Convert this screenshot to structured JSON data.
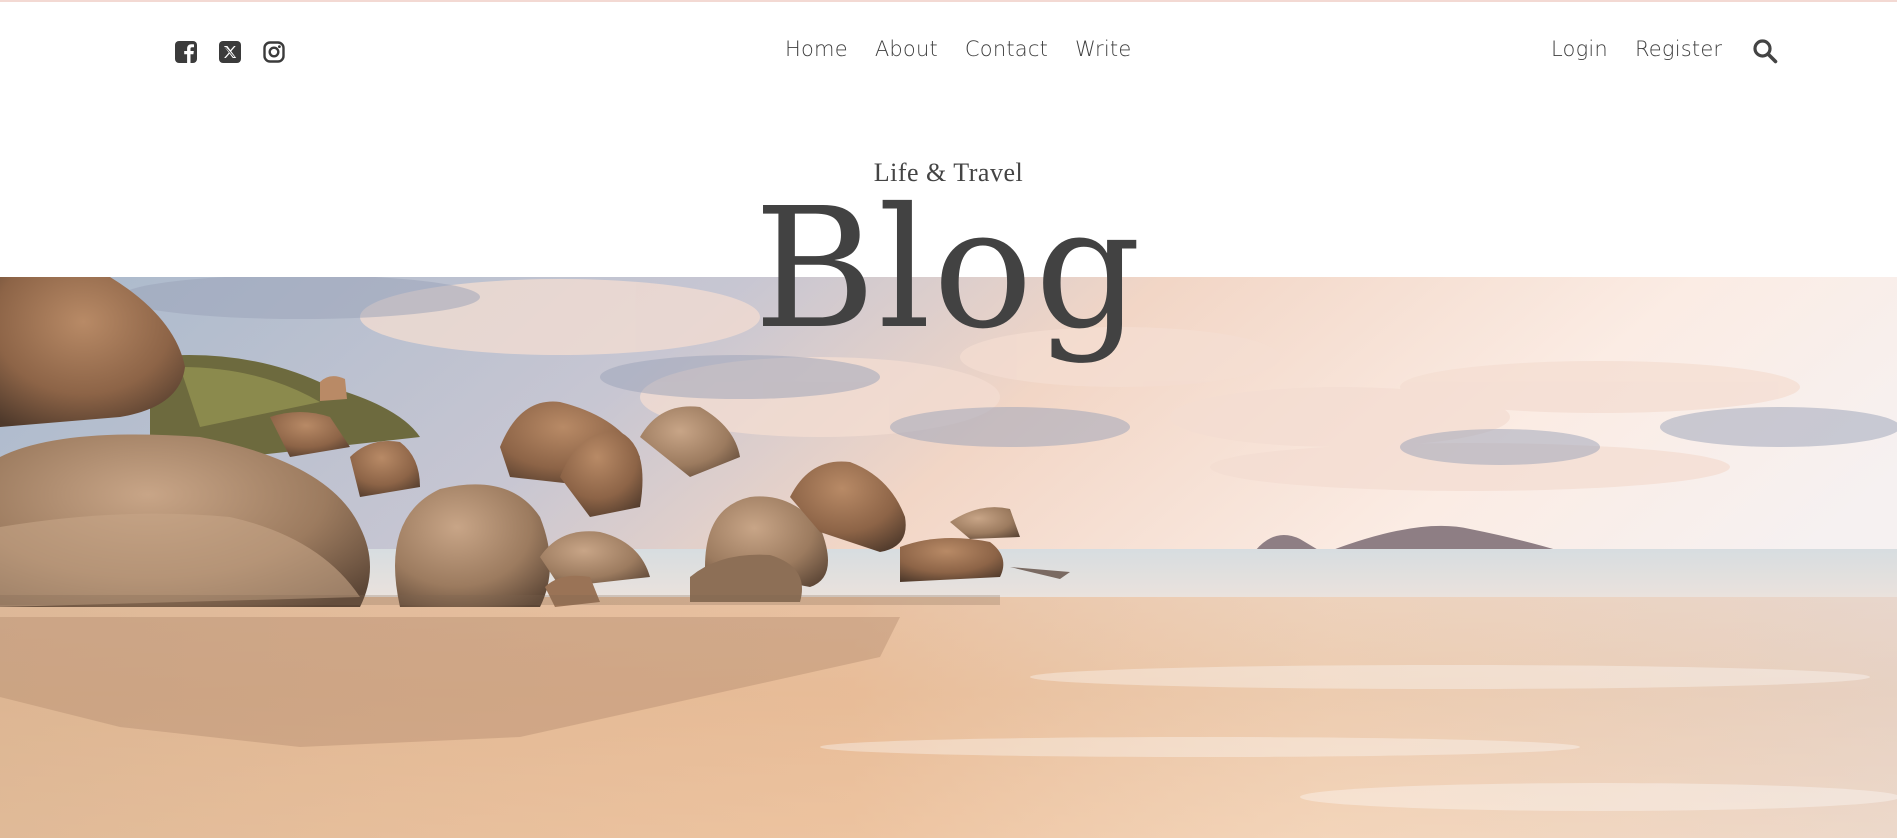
{
  "header": {
    "socials": [
      {
        "icon": "facebook-square-icon"
      },
      {
        "icon": "x-twitter-square-icon"
      },
      {
        "icon": "instagram-icon"
      }
    ],
    "nav_center": [
      "Home",
      "About",
      "Contact",
      "Write"
    ],
    "nav_right": [
      "Login",
      "Register"
    ],
    "search_icon": "search-icon"
  },
  "hero": {
    "subtitle": "Life & Travel",
    "title": "Blog",
    "image": "beach-rocks-sunset-photo"
  },
  "colors": {
    "accent_topline": "#f3d9d3",
    "text": "#444444"
  }
}
